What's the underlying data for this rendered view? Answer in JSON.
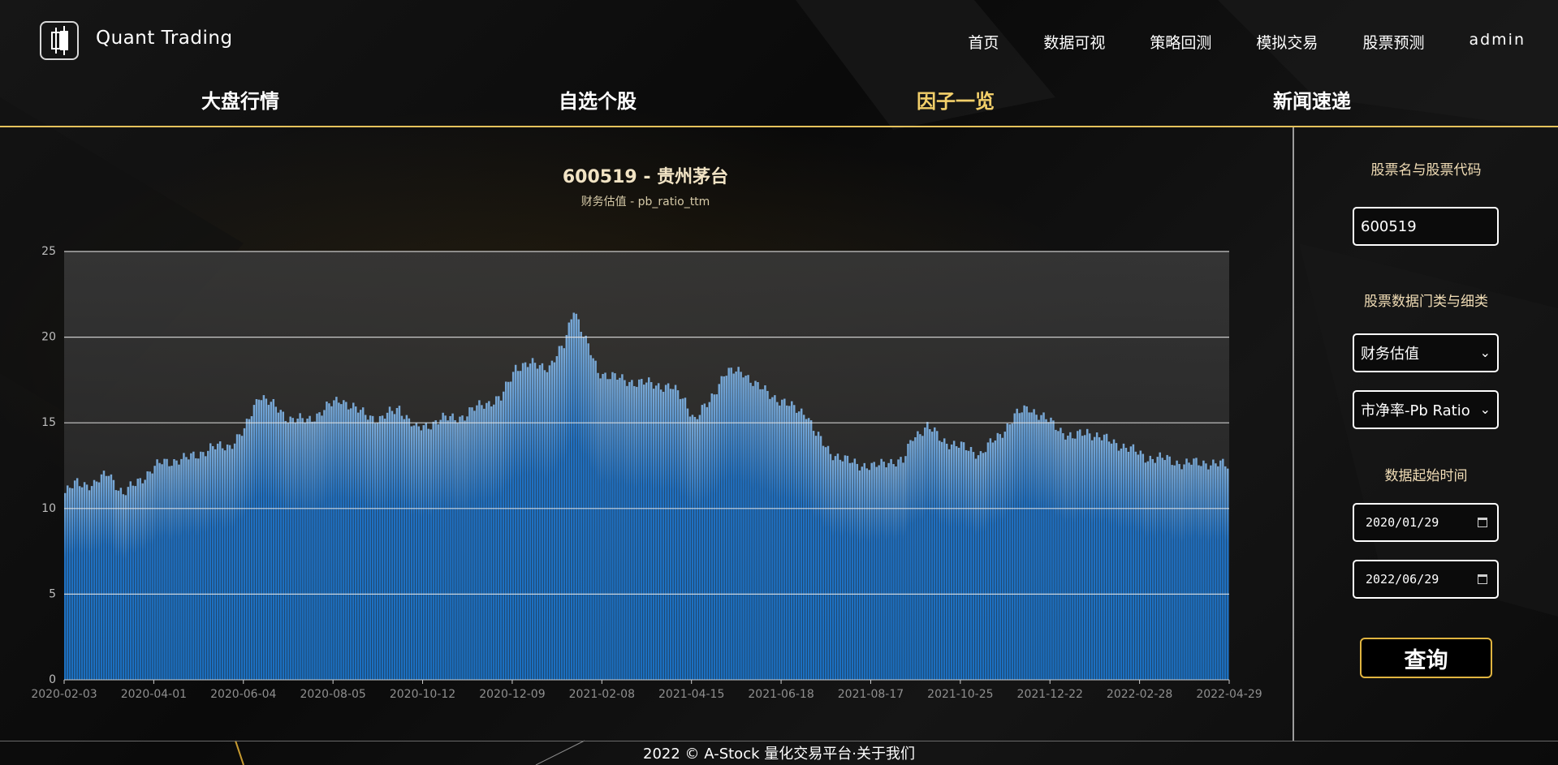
{
  "brand": {
    "name": "Quant Trading"
  },
  "nav": {
    "items": [
      "首页",
      "数据可视",
      "策略回测",
      "模拟交易",
      "股票预测"
    ],
    "user": "admin"
  },
  "subtabs": [
    "大盘行情",
    "自选个股",
    "因子一览",
    "新闻速递"
  ],
  "active_subtab": "因子一览",
  "side": {
    "stock_label": "股票名与股票代码",
    "stock_value": "600519",
    "category_label": "股票数据门类与细类",
    "category_value": "财务估值",
    "subcategory_value": "市净率-Pb Ratio",
    "date_label": "数据起始时间",
    "start_date": "2020/01/29",
    "end_date": "2022/06/29",
    "query_label": "查询"
  },
  "footer": {
    "text": "2022 © A-Stock 量化交易平台·",
    "link": "关于我们"
  },
  "colors": {
    "accent": "#e5c25c",
    "bar": "#1b6fc0",
    "title": "#f1e3c4"
  },
  "chart_data": {
    "type": "bar",
    "title": "600519 - 贵州茅台",
    "subtitle": "财务估值 - pb_ratio_ttm",
    "ylim": [
      0,
      25
    ],
    "yticks": [
      0,
      5,
      10,
      15,
      20,
      25
    ],
    "xlabels": [
      "2020-02-03",
      "2020-04-01",
      "2020-06-04",
      "2020-08-05",
      "2020-10-12",
      "2020-12-09",
      "2021-02-08",
      "2021-04-15",
      "2021-06-18",
      "2021-08-17",
      "2021-10-25",
      "2021-12-22",
      "2022-02-28",
      "2022-04-29"
    ],
    "keypoints": [
      [
        0,
        10.9
      ],
      [
        5,
        11.5
      ],
      [
        12,
        11.4
      ],
      [
        18,
        12.1
      ],
      [
        24,
        10.8
      ],
      [
        30,
        11.6
      ],
      [
        40,
        12.7
      ],
      [
        50,
        12.9
      ],
      [
        60,
        13.5
      ],
      [
        68,
        13.7
      ],
      [
        74,
        14.5
      ],
      [
        80,
        16.7
      ],
      [
        85,
        16.1
      ],
      [
        92,
        15.3
      ],
      [
        100,
        15.1
      ],
      [
        108,
        15.9
      ],
      [
        114,
        16.4
      ],
      [
        122,
        15.6
      ],
      [
        130,
        15.2
      ],
      [
        138,
        15.9
      ],
      [
        145,
        14.6
      ],
      [
        155,
        15.2
      ],
      [
        165,
        15.4
      ],
      [
        172,
        16.1
      ],
      [
        180,
        16.4
      ],
      [
        186,
        18.3
      ],
      [
        192,
        18.4
      ],
      [
        200,
        18.3
      ],
      [
        206,
        19.5
      ],
      [
        210,
        21.8
      ],
      [
        214,
        20.1
      ],
      [
        220,
        18.0
      ],
      [
        230,
        17.5
      ],
      [
        240,
        17.3
      ],
      [
        250,
        17.1
      ],
      [
        256,
        16.3
      ],
      [
        260,
        15.2
      ],
      [
        266,
        16.2
      ],
      [
        272,
        17.9
      ],
      [
        280,
        18.0
      ],
      [
        286,
        17.1
      ],
      [
        292,
        16.6
      ],
      [
        300,
        15.9
      ],
      [
        306,
        15.6
      ],
      [
        310,
        14.3
      ],
      [
        316,
        13.3
      ],
      [
        322,
        12.8
      ],
      [
        328,
        12.6
      ],
      [
        334,
        12.4
      ],
      [
        340,
        12.8
      ],
      [
        346,
        12.7
      ],
      [
        350,
        14.2
      ],
      [
        356,
        14.8
      ],
      [
        362,
        14.0
      ],
      [
        370,
        13.6
      ],
      [
        378,
        13.2
      ],
      [
        386,
        14.3
      ],
      [
        392,
        15.4
      ],
      [
        398,
        15.9
      ],
      [
        404,
        15.3
      ],
      [
        410,
        14.7
      ],
      [
        416,
        14.1
      ],
      [
        422,
        14.5
      ],
      [
        430,
        14.0
      ],
      [
        438,
        13.6
      ],
      [
        446,
        13.0
      ],
      [
        454,
        12.9
      ],
      [
        462,
        12.6
      ],
      [
        470,
        12.7
      ],
      [
        480,
        12.5
      ]
    ]
  }
}
